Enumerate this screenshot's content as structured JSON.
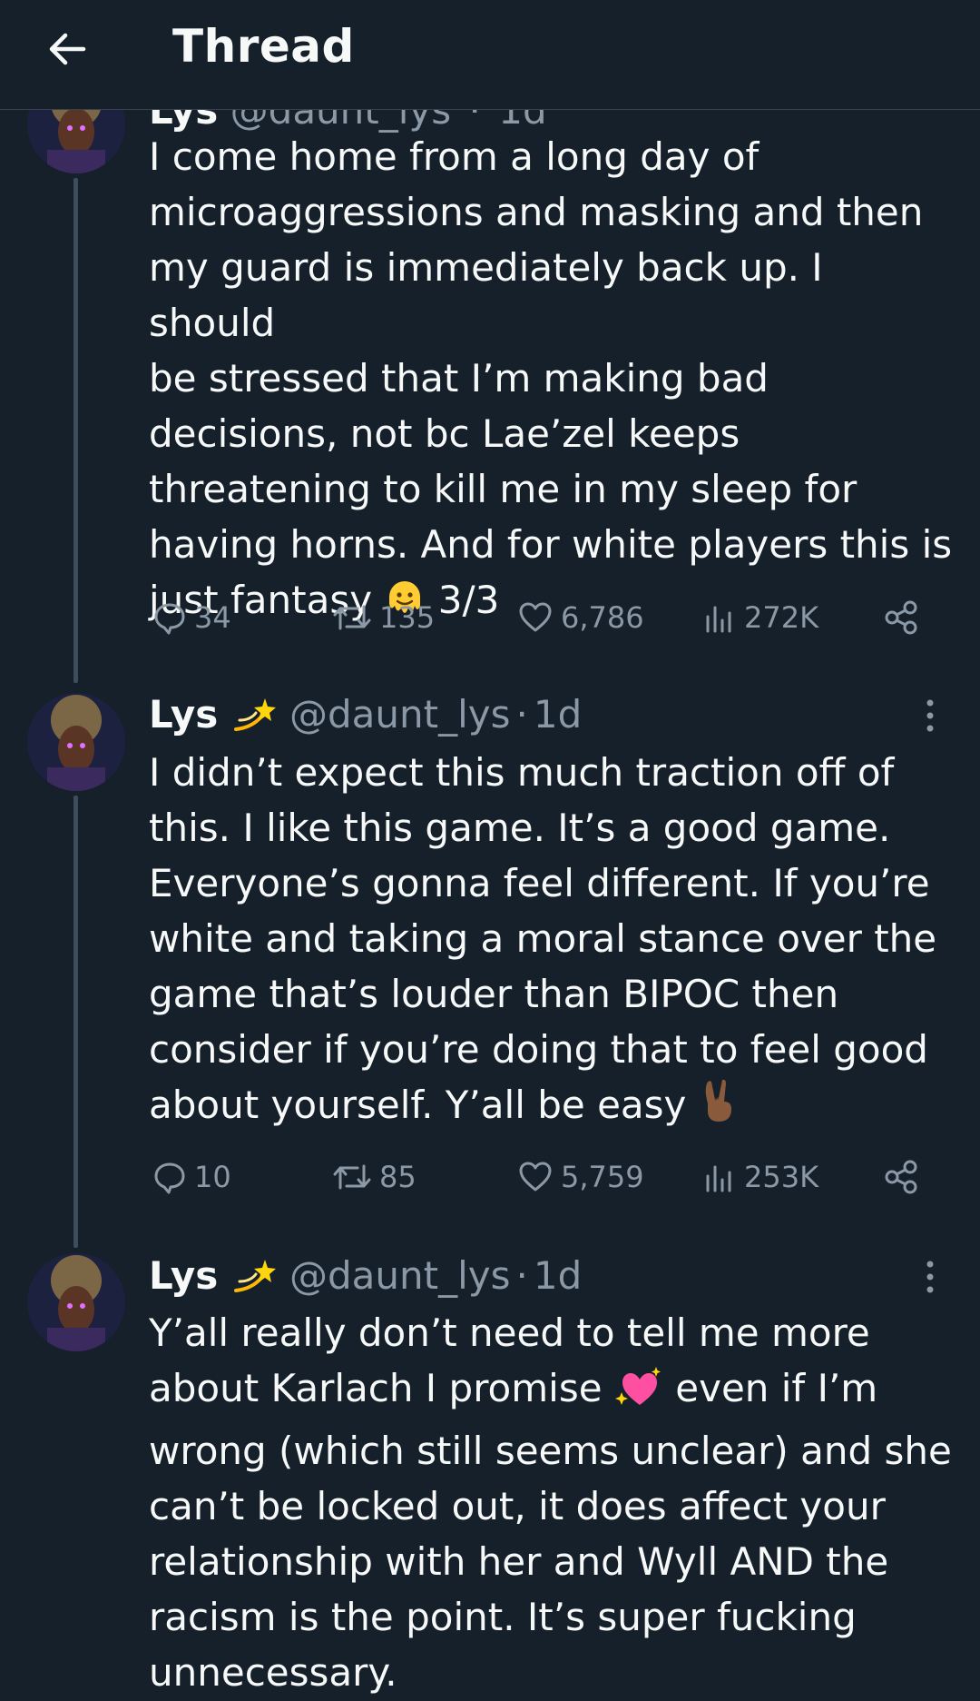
{
  "header": {
    "title": "Thread",
    "back_icon": "arrow-left-icon"
  },
  "tweets": [
    {
      "name": "Lys",
      "handle": "@daunt_lys",
      "time": "1d",
      "text_before": "I come home from a long day of\nmicroaggressions and masking and then\nmy guard is immediately back up. I should\nbe stressed that I’m making bad\ndecisions, not bc Lae’zel keeps\nthreatening to kill me in my sleep for\nhaving horns. And for white players this is\njust fantasy ",
      "emoji": "melting-face-emoji",
      "text_after": " 3/3",
      "replies": "34",
      "reposts": "135",
      "likes": "6,786",
      "views": "272K"
    },
    {
      "name": "Lys",
      "handle": "@daunt_lys",
      "time": "1d",
      "text_before": "I didn’t expect this much traction off of\nthis. I like this game. It’s a good game.\nEveryone’s gonna feel different. If you’re\nwhite and taking a moral stance over the\ngame that’s louder than BIPOC then\nconsider if you’re doing that to feel good\nabout yourself. Y’all be easy ",
      "emoji": "victory-hand-emoji",
      "text_after": "",
      "replies": "10",
      "reposts": "85",
      "likes": "5,759",
      "views": "253K"
    },
    {
      "name": "Lys",
      "handle": "@daunt_lys",
      "time": "1d",
      "text_before": "Y’all really don’t need to tell me more\nabout Karlach I promise ",
      "emoji": "sparkling-heart-emoji",
      "text_after": " even if I’m\nwrong (which still seems unclear) and she\ncan’t be locked out, it does affect your\nrelationship with her and Wyll AND the\nracism is the point. It’s super fucking\nunnecessary."
    }
  ],
  "colors": {
    "background": "#15202b",
    "text": "#f7f9f9",
    "muted": "#8b98a5",
    "divider": "#38444d",
    "thread_line": "#3d4d5c"
  }
}
